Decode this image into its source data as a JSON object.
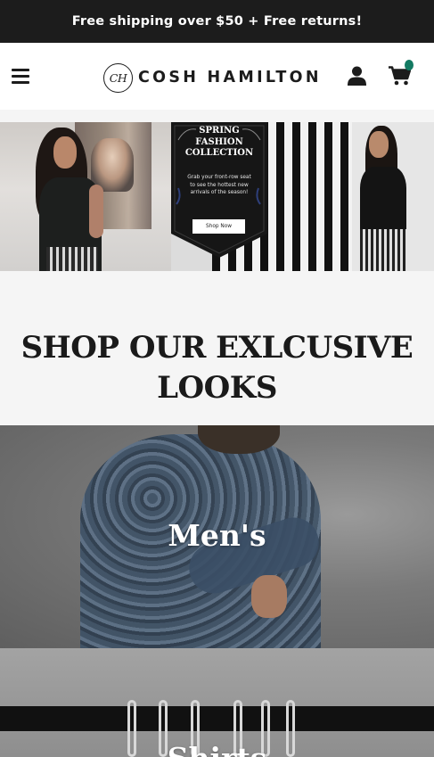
{
  "announcement": {
    "text": "Free shipping over $50 + Free returns!"
  },
  "header": {
    "logo_mark": "CH",
    "logo_text": "COSH HAMILTON",
    "colors": {
      "cart_badge": "#137a62",
      "announcement_bg": "#1c1c1c"
    }
  },
  "hero": {
    "banner_title": "SPRING\nFASHION\nCOLLECTION",
    "banner_subtitle": "Grab your front-row seat\nto see the hottest new\narrivals of the season!",
    "banner_button": "Shop Now"
  },
  "section": {
    "title": "SHOP OUR EXLCUSIVE\nLOOKS"
  },
  "collections": [
    {
      "title": "Men's"
    },
    {
      "title": "Shirts"
    }
  ],
  "icons": {
    "menu": "hamburger-menu-icon",
    "account": "user-icon",
    "cart": "shopping-cart-icon"
  }
}
